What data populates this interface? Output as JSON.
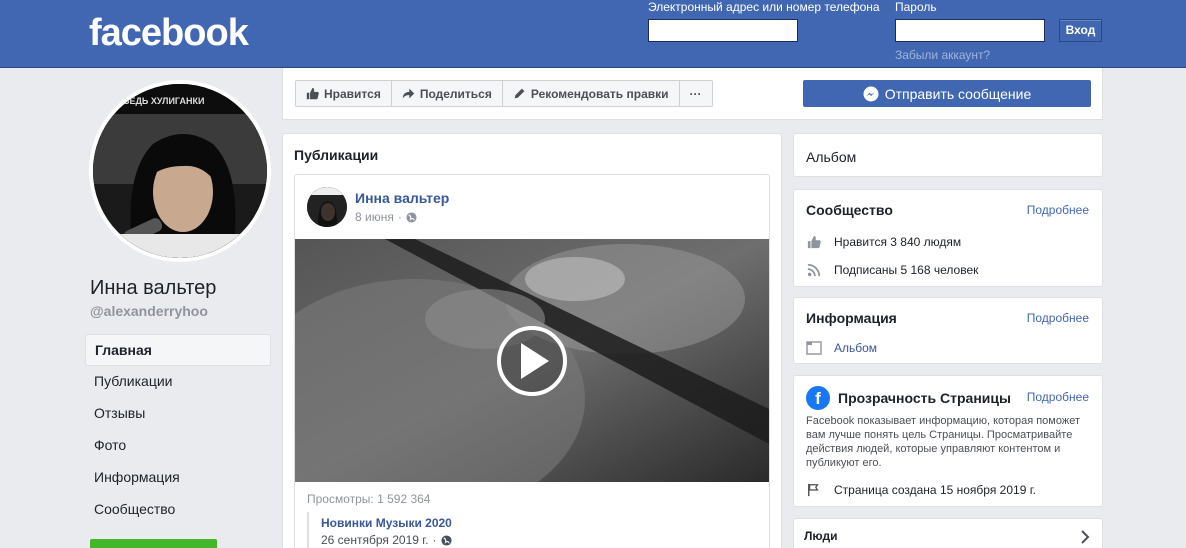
{
  "header": {
    "logo": "facebook",
    "email_label": "Электронный адрес или номер телефона",
    "password_label": "Пароль",
    "login_button": "Вход",
    "forgot_link": "Забыли аккаунт?",
    "brand_color": "#4267b2"
  },
  "profile": {
    "name": "Инна вальтер",
    "handle": "@alexanderryhoo",
    "avatar_banner_text": "ВЕДЬ ХУЛИГАНКИ"
  },
  "left_nav": {
    "items": [
      {
        "label": "Главная",
        "active": true
      },
      {
        "label": "Публикации"
      },
      {
        "label": "Отзывы"
      },
      {
        "label": "Фото"
      },
      {
        "label": "Информация"
      },
      {
        "label": "Сообщество"
      }
    ]
  },
  "actions": {
    "like": "Нравится",
    "share": "Поделиться",
    "suggest": "Рекомендовать правки",
    "more": "···",
    "send_message": "Отправить сообщение"
  },
  "publications": {
    "title": "Публикации",
    "post": {
      "author": "Инна вальтер",
      "date": "8 июня",
      "views": "Просмотры: 1 592 364",
      "shared_title": "Новинки Музыки 2020",
      "shared_date": "26 сентября 2019 г."
    }
  },
  "right": {
    "album": "Альбом",
    "community": {
      "title": "Сообщество",
      "more": "Подробнее",
      "likes": "Нравится 3 840 людям",
      "followers": "Подписаны 5 168 человек"
    },
    "info": {
      "title": "Информация",
      "more": "Подробнее",
      "album": "Альбом"
    },
    "transparency": {
      "title": "Прозрачность Страницы",
      "more": "Подробнее",
      "description": "Facebook показывает информацию, которая поможет вам лучше понять цель Страницы. Просматривайте действия людей, которые управляют контентом и публикуют его.",
      "created": "Страница создана 15 ноября 2019 г."
    },
    "people": {
      "title": "Люди"
    }
  }
}
